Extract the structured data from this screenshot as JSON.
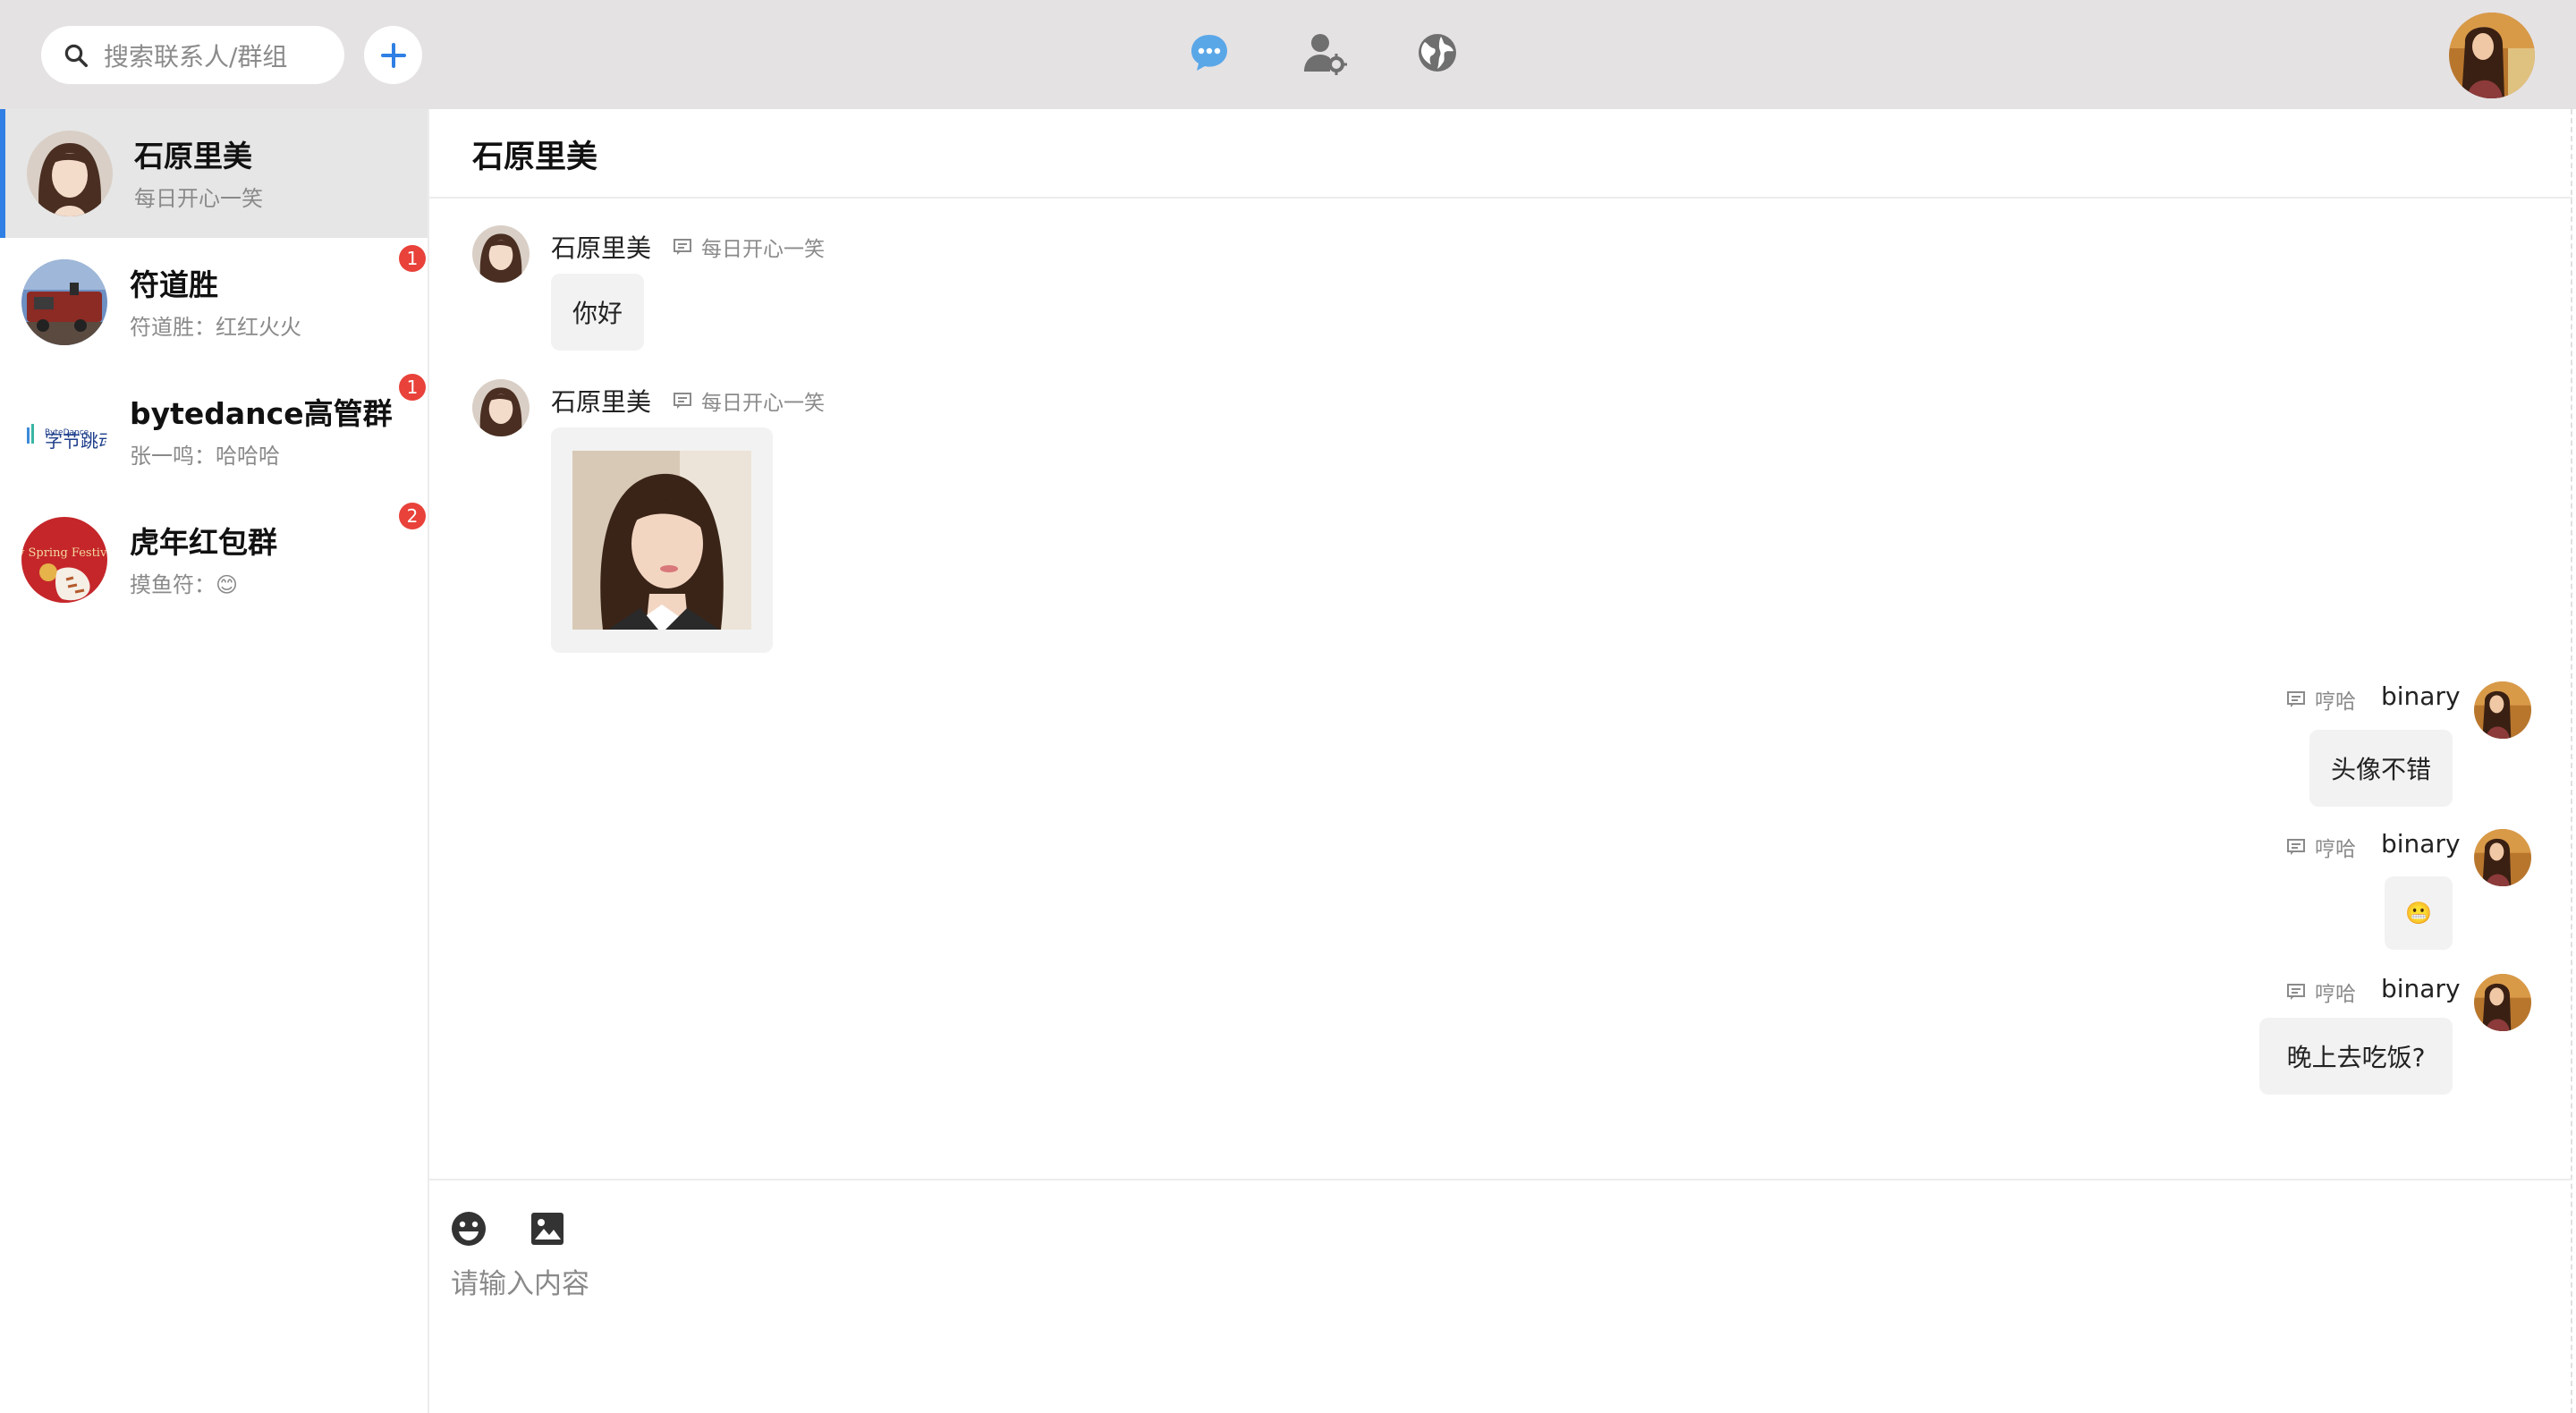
{
  "search": {
    "placeholder": "搜索联系人/群组"
  },
  "nav": {
    "icons": [
      "search-icon",
      "plus-icon",
      "chat-bubble-icon",
      "user-settings-icon",
      "globe-icon"
    ],
    "active_color": "#5aa7e8",
    "inactive_color": "#6f6f6f"
  },
  "conversations": [
    {
      "name": "石原里美",
      "preview": "每日开心一笑",
      "badge": "",
      "active": true
    },
    {
      "name": "符道胜",
      "preview": "符道胜：红红火火",
      "badge": "1"
    },
    {
      "name": "bytedance高管群",
      "preview": "张一鸣：哈哈哈",
      "badge": "1"
    },
    {
      "name": "虎年红包群",
      "preview": "摸鱼符：😊",
      "badge": "2"
    }
  ],
  "chat": {
    "title": "石原里美",
    "messages": [
      {
        "side": "left",
        "sender": "石原里美",
        "signature": "每日开心一笑",
        "text": "你好"
      },
      {
        "side": "left",
        "sender": "石原里美",
        "signature": "每日开心一笑",
        "image": "portrait-photo"
      },
      {
        "side": "right",
        "sender": "binary",
        "signature": "哼哈",
        "text": "头像不错"
      },
      {
        "side": "right",
        "sender": "binary",
        "signature": "哼哈",
        "text": "😬"
      },
      {
        "side": "right",
        "sender": "binary",
        "signature": "哼哈",
        "text": "晚上去吃饭?"
      }
    ]
  },
  "composer": {
    "placeholder": "请输入内容"
  },
  "colors": {
    "accent": "#2f7fe4",
    "badge": "#e8423a",
    "topbar": "#e5e2e4"
  }
}
